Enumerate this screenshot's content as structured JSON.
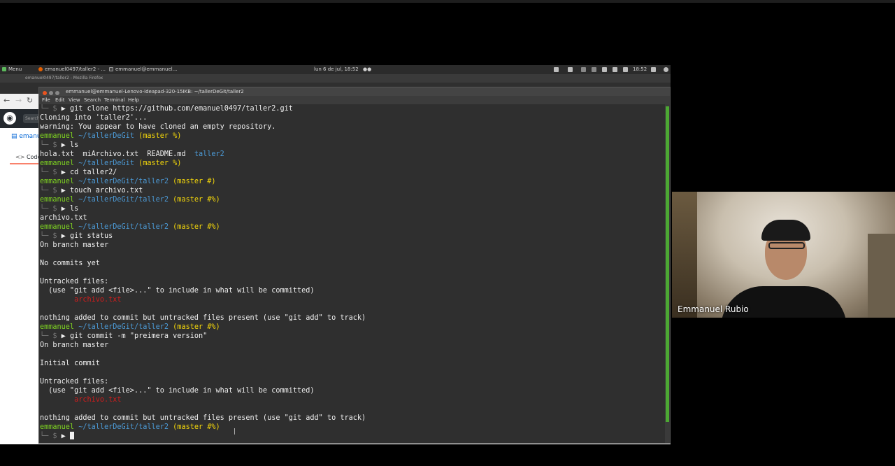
{
  "panel": {
    "menu_label": "Menu",
    "firefox_task": "emanuel0497/taller2 - ...",
    "terminal_task": "emmanuel@emmanuel...",
    "datetime": "lun 6 de jul, 18:52",
    "clock": "18:52"
  },
  "firefox": {
    "window_title": "emanuel0497/taller2 - Mozilla Firefox",
    "search_placeholder": "Search",
    "repo_name": "emanu",
    "code_tab": "Code"
  },
  "terminal": {
    "title": "emmanuel@emmanuel-Lenovo-ideapad-320-15IKB: ~/tallerDeGit/taller2",
    "menu": [
      "File",
      "Edit",
      "View",
      "Search",
      "Terminal",
      "Help"
    ],
    "user": "emmanuel",
    "lines": [
      {
        "type": "cmd",
        "text": "git clone https://github.com/emanuel0497/taller2.git"
      },
      {
        "type": "out",
        "text": "Cloning into 'taller2'..."
      },
      {
        "type": "out",
        "text": "warning: You appear to have cloned an empty repository."
      },
      {
        "type": "prompt",
        "path": "~/tallerDeGit",
        "branch": "(master %)"
      },
      {
        "type": "cmd",
        "text": "ls"
      },
      {
        "type": "ls",
        "files": [
          "hola.txt",
          "miArchivo.txt",
          "README.md"
        ],
        "dir": "taller2"
      },
      {
        "type": "prompt",
        "path": "~/tallerDeGit",
        "branch": "(master %)"
      },
      {
        "type": "cmd",
        "text": "cd taller2/"
      },
      {
        "type": "prompt",
        "path": "~/tallerDeGit/taller2",
        "branch": "(master #)"
      },
      {
        "type": "cmd",
        "text": "touch archivo.txt"
      },
      {
        "type": "prompt",
        "path": "~/tallerDeGit/taller2",
        "branch": "(master #%)"
      },
      {
        "type": "cmd",
        "text": "ls"
      },
      {
        "type": "out",
        "text": "archivo.txt"
      },
      {
        "type": "prompt",
        "path": "~/tallerDeGit/taller2",
        "branch": "(master #%)"
      },
      {
        "type": "cmd",
        "text": "git status"
      },
      {
        "type": "out",
        "text": "On branch master"
      },
      {
        "type": "out",
        "text": ""
      },
      {
        "type": "out",
        "text": "No commits yet"
      },
      {
        "type": "out",
        "text": ""
      },
      {
        "type": "out",
        "text": "Untracked files:"
      },
      {
        "type": "out",
        "text": "  (use \"git add <file>...\" to include in what will be committed)"
      },
      {
        "type": "red",
        "text": "        archivo.txt"
      },
      {
        "type": "out",
        "text": ""
      },
      {
        "type": "out",
        "text": "nothing added to commit but untracked files present (use \"git add\" to track)"
      },
      {
        "type": "prompt",
        "path": "~/tallerDeGit/taller2",
        "branch": "(master #%)"
      },
      {
        "type": "cmd",
        "text": "git commit -m \"preimera version\""
      },
      {
        "type": "out",
        "text": "On branch master"
      },
      {
        "type": "out",
        "text": ""
      },
      {
        "type": "out",
        "text": "Initial commit"
      },
      {
        "type": "out",
        "text": ""
      },
      {
        "type": "out",
        "text": "Untracked files:"
      },
      {
        "type": "out",
        "text": "  (use \"git add <file>...\" to include in what will be committed)"
      },
      {
        "type": "red",
        "text": "        archivo.txt"
      },
      {
        "type": "out",
        "text": ""
      },
      {
        "type": "out",
        "text": "nothing added to commit but untracked files present (use \"git add\" to track)"
      },
      {
        "type": "prompt",
        "path": "~/tallerDeGit/taller2",
        "branch": "(master #%)"
      },
      {
        "type": "cmd",
        "text": ""
      }
    ]
  },
  "webcam": {
    "participant_name": "Emmanuel Rubio"
  },
  "colors": {
    "prompt_user": "#7ed321",
    "prompt_path": "#4c9ad6",
    "prompt_branch": "#f5d80a",
    "untracked_file": "#d11d1d",
    "directory": "#4c9ad6"
  }
}
